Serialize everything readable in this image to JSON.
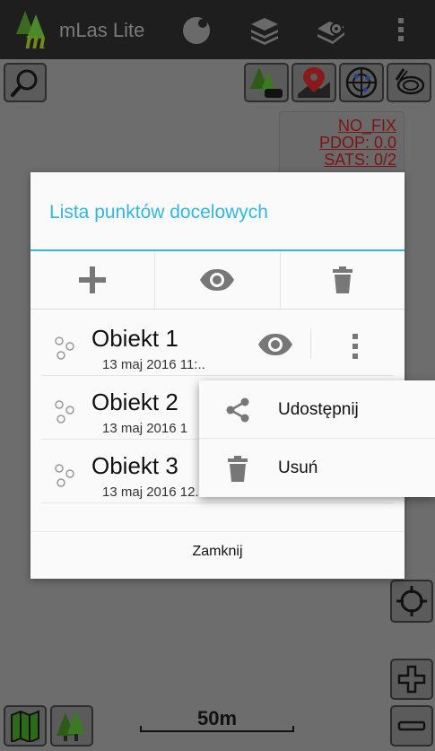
{
  "app": {
    "title": "mLas Lite"
  },
  "gps": {
    "fix": "NO_FIX",
    "pdop": "PDOP: 0.0",
    "sats": "SATS: 0/2"
  },
  "scale": {
    "label": "50m"
  },
  "dialog": {
    "title": "Lista punktów docelowych",
    "items": [
      {
        "name": "Obiekt 1",
        "date": "13 maj 2016 11:.."
      },
      {
        "name": "Obiekt 2",
        "date": "13 maj 2016 1"
      },
      {
        "name": "Obiekt 3",
        "date": "13 maj 2016 12..."
      }
    ],
    "close_label": "Zamknij"
  },
  "popup": {
    "share_label": "Udostępnij",
    "delete_label": "Usuń"
  },
  "colors": {
    "accent": "#33b5e5",
    "gps_text": "#7b1414"
  }
}
